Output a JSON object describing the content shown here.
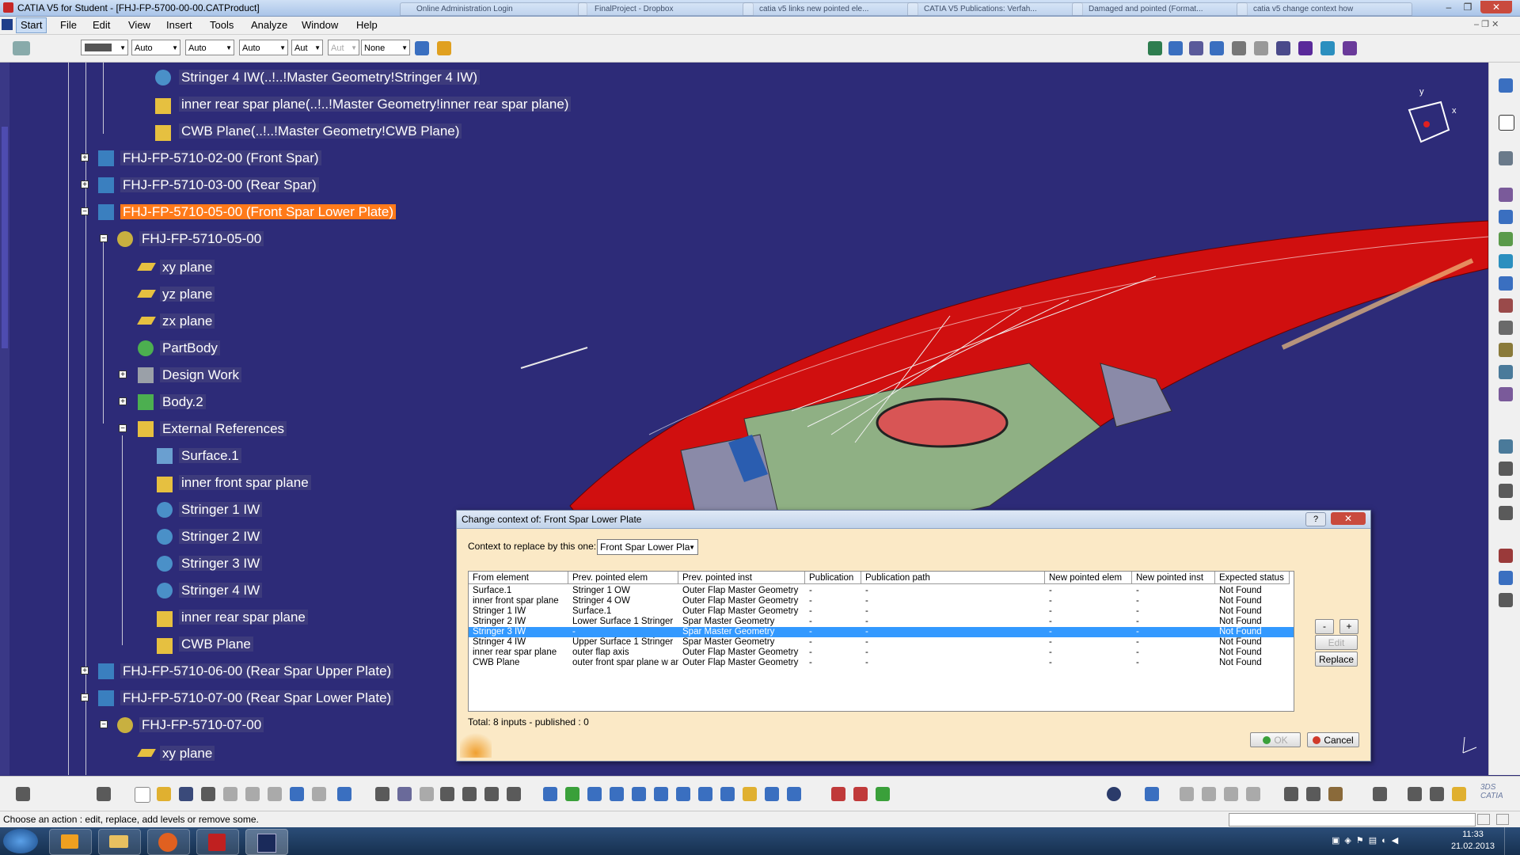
{
  "window": {
    "title": "CATIA V5 for Student - [FHJ-FP-5700-00-00.CATProduct]",
    "background_tabs": [
      "Online Administration Login",
      "FinalProject - Dropbox",
      "catia v5 links new pointed ele...",
      "CATIA V5 Publications: Verfah...",
      "Damaged and pointed (Format...",
      "catia v5 change context how"
    ]
  },
  "menu": {
    "items": [
      "Start",
      "File",
      "Edit",
      "View",
      "Insert",
      "Tools",
      "Analyze",
      "Window",
      "Help"
    ]
  },
  "toolbar": {
    "color_value": "",
    "combo1": "Auto",
    "combo2": "Auto",
    "combo3": "Auto",
    "combo4": "Aut",
    "combo5": "Aut",
    "layer": "None"
  },
  "tree": {
    "nodes": [
      {
        "label": "Stringer 4 IW(..!..!Master Geometry!Stringer 4 IW)"
      },
      {
        "label": "inner rear spar plane(..!..!Master Geometry!inner rear spar plane)"
      },
      {
        "label": "CWB Plane(..!..!Master Geometry!CWB Plane)"
      },
      {
        "label": "FHJ-FP-5710-02-00 (Front Spar)"
      },
      {
        "label": "FHJ-FP-5710-03-00 (Rear Spar)"
      },
      {
        "label": "FHJ-FP-5710-05-00 (Front Spar Lower Plate)"
      },
      {
        "label": "FHJ-FP-5710-05-00"
      },
      {
        "label": "xy plane"
      },
      {
        "label": "yz plane"
      },
      {
        "label": "zx plane"
      },
      {
        "label": "PartBody"
      },
      {
        "label": "Design Work"
      },
      {
        "label": "Body.2"
      },
      {
        "label": "External References"
      },
      {
        "label": "Surface.1"
      },
      {
        "label": "inner front spar plane"
      },
      {
        "label": "Stringer 1 IW"
      },
      {
        "label": "Stringer 2 IW"
      },
      {
        "label": "Stringer 3 IW"
      },
      {
        "label": "Stringer 4 IW"
      },
      {
        "label": "inner rear spar plane"
      },
      {
        "label": "CWB Plane"
      },
      {
        "label": "FHJ-FP-5710-06-00 (Rear Spar Upper Plate)"
      },
      {
        "label": "FHJ-FP-5710-07-00 (Rear Spar Lower Plate)"
      },
      {
        "label": "FHJ-FP-5710-07-00"
      },
      {
        "label": "xy plane"
      }
    ]
  },
  "compass": {
    "x_label": "x",
    "y_label": "y"
  },
  "dialog": {
    "title": "Change context of: Front Spar Lower Plate",
    "help_label": "?",
    "close_label": "✕",
    "context_label": "Context to replace by this one:",
    "context_value": "Front Spar Lower Pla",
    "columns": [
      "From element",
      "Prev. pointed elem",
      "Prev. pointed inst",
      "Publication",
      "Publication path",
      "New pointed elem",
      "New pointed inst",
      "Expected status"
    ],
    "rows": [
      [
        "Surface.1",
        "Stringer 1 OW",
        "Outer Flap Master Geometry",
        "-",
        "-",
        "-",
        "-",
        "Not Found"
      ],
      [
        "inner front spar plane",
        "Stringer 4 OW",
        "Outer Flap Master Geometry",
        "-",
        "-",
        "-",
        "-",
        "Not Found"
      ],
      [
        "Stringer 1 IW",
        "Surface.1",
        "Outer Flap Master Geometry",
        "-",
        "-",
        "-",
        "-",
        "Not Found"
      ],
      [
        "Stringer 2 IW",
        "Lower Surface 1 Stringer",
        "Spar Master Geometry",
        "-",
        "-",
        "-",
        "-",
        "Not Found"
      ],
      [
        "Stringer 3 IW",
        "-",
        "Spar Master Geometry",
        "-",
        "-",
        "-",
        "-",
        "Not Found"
      ],
      [
        "Stringer 4 IW",
        "Upper Surface 1 Stringer",
        "Spar Master Geometry",
        "-",
        "-",
        "-",
        "-",
        "Not Found"
      ],
      [
        "inner rear spar plane",
        "outer flap axis",
        "Outer Flap Master Geometry",
        "-",
        "-",
        "-",
        "-",
        "Not Found"
      ],
      [
        "CWB Plane",
        "outer front spar plane w angle",
        "Outer Flap Master Geometry",
        "-",
        "-",
        "-",
        "-",
        "Not Found"
      ]
    ],
    "selected_row": 4,
    "total_text": "Total: 8 inputs - published : 0",
    "minus_label": "-",
    "plus_label": "+",
    "edit_label": "Edit",
    "replace_label": "Replace",
    "ok_label": "OK",
    "cancel_label": "Cancel"
  },
  "status": {
    "message": "Choose an action : edit, replace, add levels or remove some."
  },
  "taskbar": {
    "time": "11:33",
    "date": "21.02.2013"
  },
  "colors": {
    "background": "#2d2b78",
    "selected_node": "#ff7a1a",
    "dialog_bg": "#fbe9c6",
    "row_selected": "#3399ff"
  }
}
